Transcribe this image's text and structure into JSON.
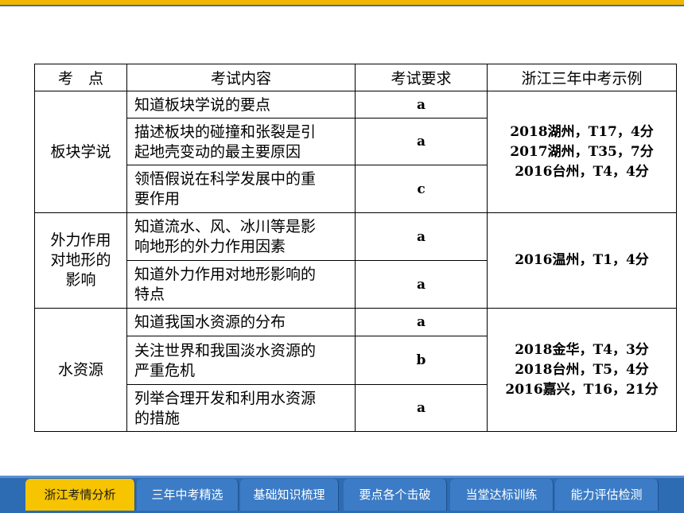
{
  "table": {
    "headers": [
      "考　点",
      "考试内容",
      "考试要求",
      "浙江三年中考示例"
    ],
    "groups": [
      {
        "topic": [
          "板块学说"
        ],
        "rows": [
          {
            "content": [
              "知道板块学说的要点"
            ],
            "req": "a"
          },
          {
            "content": [
              "描述板块的碰撞和张裂是引",
              "起地壳变动的最主要原因"
            ],
            "req": "a"
          },
          {
            "content": [
              "领悟假说在科学发展中的重",
              "要作用"
            ],
            "req": "c"
          }
        ],
        "examples": [
          "2018湖州，T17，4分",
          "2017湖州，T35，7分",
          "2016台州，T4，4分"
        ]
      },
      {
        "topic": [
          "外力作用",
          "对地形的",
          "影响"
        ],
        "rows": [
          {
            "content": [
              "知道流水、风、冰川等是影",
              "响地形的外力作用因素"
            ],
            "req": "a"
          },
          {
            "content": [
              "知道外力作用对地形影响的",
              "特点"
            ],
            "req": "a"
          }
        ],
        "examples": [
          "2016温州，T1，4分"
        ]
      },
      {
        "topic": [
          "水资源"
        ],
        "rows": [
          {
            "content": [
              "知道我国水资源的分布"
            ],
            "req": "a"
          },
          {
            "content": [
              "关注世界和我国淡水资源的",
              "严重危机"
            ],
            "req": "b"
          },
          {
            "content": [
              "列举合理开发和利用水资源",
              "的措施"
            ],
            "req": "a"
          }
        ],
        "examples": [
          "2018金华，T4，3分",
          "2018台州，T5，4分",
          "2016嘉兴，T16，21分"
        ]
      }
    ]
  },
  "nav": {
    "tabs": [
      "浙江考情分析",
      "三年中考精选",
      "基础知识梳理",
      "要点各个击破",
      "当堂达标训练",
      "能力评估检测"
    ],
    "active_index": 0
  },
  "colors": {
    "accent_yellow": "#f6c400",
    "nav_blue": "#2d6bb3"
  }
}
